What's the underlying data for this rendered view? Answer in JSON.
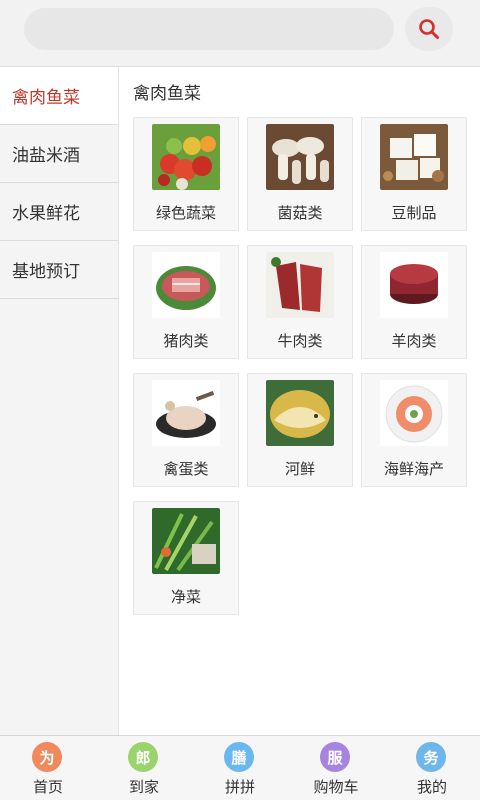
{
  "search": {
    "placeholder": ""
  },
  "sidebar": {
    "items": [
      {
        "label": "禽肉鱼菜",
        "active": true
      },
      {
        "label": "油盐米酒"
      },
      {
        "label": "水果鲜花"
      },
      {
        "label": "基地预订"
      }
    ]
  },
  "content": {
    "title": "禽肉鱼菜",
    "categories": [
      {
        "label": "绿色蔬菜"
      },
      {
        "label": "菌菇类"
      },
      {
        "label": "豆制品"
      },
      {
        "label": "猪肉类"
      },
      {
        "label": "牛肉类"
      },
      {
        "label": "羊肉类"
      },
      {
        "label": "禽蛋类"
      },
      {
        "label": "河鲜"
      },
      {
        "label": "海鲜海产"
      },
      {
        "label": "净菜"
      }
    ]
  },
  "bottomnav": {
    "items": [
      {
        "label": "首页",
        "icon": "home-icon",
        "glyph": "为",
        "color": "#f08a5d"
      },
      {
        "label": "到家",
        "icon": "delivery-icon",
        "glyph": "郎",
        "color": "#9bd36c"
      },
      {
        "label": "拼拼",
        "icon": "group-buy-icon",
        "glyph": "膳",
        "color": "#6ab8f0"
      },
      {
        "label": "购物车",
        "icon": "cart-icon",
        "glyph": "服",
        "color": "#a784e0"
      },
      {
        "label": "我的",
        "icon": "profile-icon",
        "glyph": "务",
        "color": "#6fb6ea"
      }
    ]
  },
  "colors": {
    "accent": "#c0392b",
    "sidebar_bg": "#f4f4f4"
  }
}
